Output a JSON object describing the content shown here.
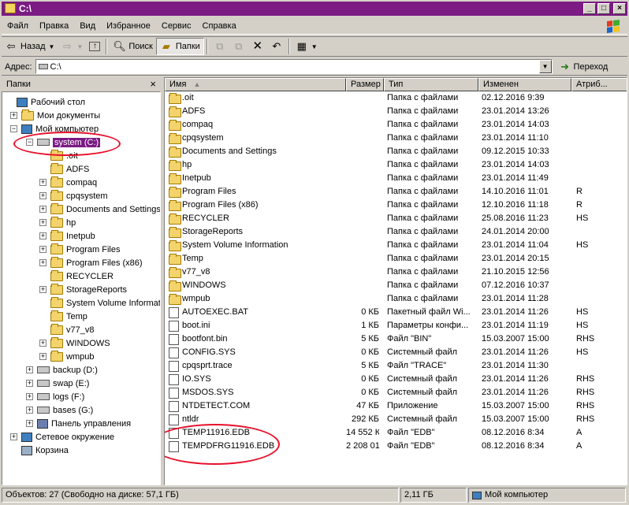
{
  "window": {
    "title": "C:\\"
  },
  "menu": [
    "Файл",
    "Правка",
    "Вид",
    "Избранное",
    "Сервис",
    "Справка"
  ],
  "toolbar": {
    "back": "Назад",
    "search": "Поиск",
    "folders": "Папки"
  },
  "address": {
    "label": "Адрес:",
    "value": "C:\\",
    "go": "Переход"
  },
  "left_pane": {
    "title": "Папки"
  },
  "tree": [
    {
      "label": "Рабочий стол",
      "level": 0,
      "icon": "desktop-icon",
      "expander": ""
    },
    {
      "label": "Мои документы",
      "level": 1,
      "icon": "folder-icon",
      "expander": "+"
    },
    {
      "label": "Мой компьютер",
      "level": 1,
      "icon": "computer-icon",
      "expander": "-"
    },
    {
      "label": "system (C:)",
      "level": 2,
      "icon": "drive-icon",
      "expander": "-",
      "selected": true
    },
    {
      "label": ".oit",
      "level": 3,
      "icon": "folder-icon",
      "expander": ""
    },
    {
      "label": "ADFS",
      "level": 3,
      "icon": "folder-icon",
      "expander": ""
    },
    {
      "label": "compaq",
      "level": 3,
      "icon": "folder-icon",
      "expander": "+"
    },
    {
      "label": "cpqsystem",
      "level": 3,
      "icon": "folder-icon",
      "expander": "+"
    },
    {
      "label": "Documents and Settings",
      "level": 3,
      "icon": "folder-icon",
      "expander": "+"
    },
    {
      "label": "hp",
      "level": 3,
      "icon": "folder-icon",
      "expander": "+"
    },
    {
      "label": "Inetpub",
      "level": 3,
      "icon": "folder-icon",
      "expander": "+"
    },
    {
      "label": "Program Files",
      "level": 3,
      "icon": "folder-icon",
      "expander": "+"
    },
    {
      "label": "Program Files (x86)",
      "level": 3,
      "icon": "folder-icon",
      "expander": "+"
    },
    {
      "label": "RECYCLER",
      "level": 3,
      "icon": "folder-icon",
      "expander": ""
    },
    {
      "label": "StorageReports",
      "level": 3,
      "icon": "folder-icon",
      "expander": "+"
    },
    {
      "label": "System Volume Information",
      "level": 3,
      "icon": "folder-icon",
      "expander": ""
    },
    {
      "label": "Temp",
      "level": 3,
      "icon": "folder-icon",
      "expander": ""
    },
    {
      "label": "v77_v8",
      "level": 3,
      "icon": "folder-icon",
      "expander": ""
    },
    {
      "label": "WINDOWS",
      "level": 3,
      "icon": "folder-icon",
      "expander": "+"
    },
    {
      "label": "wmpub",
      "level": 3,
      "icon": "folder-icon",
      "expander": "+"
    },
    {
      "label": "backup (D:)",
      "level": 2,
      "icon": "drive-icon",
      "expander": "+"
    },
    {
      "label": "swap (E:)",
      "level": 2,
      "icon": "drive-icon",
      "expander": "+"
    },
    {
      "label": "logs (F:)",
      "level": 2,
      "icon": "drive-icon",
      "expander": "+"
    },
    {
      "label": "bases (G:)",
      "level": 2,
      "icon": "drive-icon",
      "expander": "+"
    },
    {
      "label": "Панель управления",
      "level": 2,
      "icon": "control-panel-icon",
      "expander": "+"
    },
    {
      "label": "Сетевое окружение",
      "level": 1,
      "icon": "network-icon",
      "expander": "+"
    },
    {
      "label": "Корзина",
      "level": 1,
      "icon": "recycle-bin-icon",
      "expander": ""
    }
  ],
  "columns": {
    "name": "Имя",
    "size": "Размер",
    "type": "Тип",
    "modified": "Изменен",
    "attr": "Атриб..."
  },
  "files": [
    {
      "name": ".oit",
      "size": "",
      "type": "Папка с файлами",
      "modified": "02.12.2016 9:39",
      "attr": "",
      "icon": "folder"
    },
    {
      "name": "ADFS",
      "size": "",
      "type": "Папка с файлами",
      "modified": "23.01.2014 13:26",
      "attr": "",
      "icon": "folder"
    },
    {
      "name": "compaq",
      "size": "",
      "type": "Папка с файлами",
      "modified": "23.01.2014 14:03",
      "attr": "",
      "icon": "folder"
    },
    {
      "name": "cpqsystem",
      "size": "",
      "type": "Папка с файлами",
      "modified": "23.01.2014 11:10",
      "attr": "",
      "icon": "folder"
    },
    {
      "name": "Documents and Settings",
      "size": "",
      "type": "Папка с файлами",
      "modified": "09.12.2015 10:33",
      "attr": "",
      "icon": "folder"
    },
    {
      "name": "hp",
      "size": "",
      "type": "Папка с файлами",
      "modified": "23.01.2014 14:03",
      "attr": "",
      "icon": "folder"
    },
    {
      "name": "Inetpub",
      "size": "",
      "type": "Папка с файлами",
      "modified": "23.01.2014 11:49",
      "attr": "",
      "icon": "folder"
    },
    {
      "name": "Program Files",
      "size": "",
      "type": "Папка с файлами",
      "modified": "14.10.2016 11:01",
      "attr": "R",
      "icon": "folder"
    },
    {
      "name": "Program Files (x86)",
      "size": "",
      "type": "Папка с файлами",
      "modified": "12.10.2016 11:18",
      "attr": "R",
      "icon": "folder"
    },
    {
      "name": "RECYCLER",
      "size": "",
      "type": "Папка с файлами",
      "modified": "25.08.2016 11:23",
      "attr": "HS",
      "icon": "folder"
    },
    {
      "name": "StorageReports",
      "size": "",
      "type": "Папка с файлами",
      "modified": "24.01.2014 20:00",
      "attr": "",
      "icon": "folder"
    },
    {
      "name": "System Volume Information",
      "size": "",
      "type": "Папка с файлами",
      "modified": "23.01.2014 11:04",
      "attr": "HS",
      "icon": "folder"
    },
    {
      "name": "Temp",
      "size": "",
      "type": "Папка с файлами",
      "modified": "23.01.2014 20:15",
      "attr": "",
      "icon": "folder"
    },
    {
      "name": "v77_v8",
      "size": "",
      "type": "Папка с файлами",
      "modified": "21.10.2015 12:56",
      "attr": "",
      "icon": "folder"
    },
    {
      "name": "WINDOWS",
      "size": "",
      "type": "Папка с файлами",
      "modified": "07.12.2016 10:37",
      "attr": "",
      "icon": "folder"
    },
    {
      "name": "wmpub",
      "size": "",
      "type": "Папка с файлами",
      "modified": "23.01.2014 11:28",
      "attr": "",
      "icon": "folder"
    },
    {
      "name": "AUTOEXEC.BAT",
      "size": "0 КБ",
      "type": "Пакетный файл Wi...",
      "modified": "23.01.2014 11:26",
      "attr": "HS",
      "icon": "file"
    },
    {
      "name": "boot.ini",
      "size": "1 КБ",
      "type": "Параметры конфи...",
      "modified": "23.01.2014 11:19",
      "attr": "HS",
      "icon": "file"
    },
    {
      "name": "bootfont.bin",
      "size": "5 КБ",
      "type": "Файл \"BIN\"",
      "modified": "15.03.2007 15:00",
      "attr": "RHS",
      "icon": "file"
    },
    {
      "name": "CONFIG.SYS",
      "size": "0 КБ",
      "type": "Системный файл",
      "modified": "23.01.2014 11:26",
      "attr": "HS",
      "icon": "file"
    },
    {
      "name": "cpqsprt.trace",
      "size": "5 КБ",
      "type": "Файл \"TRACE\"",
      "modified": "23.01.2014 11:30",
      "attr": "",
      "icon": "file"
    },
    {
      "name": "IO.SYS",
      "size": "0 КБ",
      "type": "Системный файл",
      "modified": "23.01.2014 11:26",
      "attr": "RHS",
      "icon": "file"
    },
    {
      "name": "MSDOS.SYS",
      "size": "0 КБ",
      "type": "Системный файл",
      "modified": "23.01.2014 11:26",
      "attr": "RHS",
      "icon": "file"
    },
    {
      "name": "NTDETECT.COM",
      "size": "47 КБ",
      "type": "Приложение",
      "modified": "15.03.2007 15:00",
      "attr": "RHS",
      "icon": "file"
    },
    {
      "name": "ntldr",
      "size": "292 КБ",
      "type": "Системный файл",
      "modified": "15.03.2007 15:00",
      "attr": "RHS",
      "icon": "file"
    },
    {
      "name": "TEMP11916.EDB",
      "size": "14 552 КБ",
      "type": "Файл \"EDB\"",
      "modified": "08.12.2016 8:34",
      "attr": "A",
      "icon": "file"
    },
    {
      "name": "TEMPDFRG11916.EDB",
      "size": "2 208 016 КБ",
      "type": "Файл \"EDB\"",
      "modified": "08.12.2016 8:34",
      "attr": "A",
      "icon": "file"
    }
  ],
  "status": {
    "objects": "Объектов: 27 (Свободно на диске: 57,1 ГБ)",
    "size": "2,11 ГБ",
    "location": "Мой компьютер"
  },
  "colors": {
    "title_bar": "#7b1b83",
    "highlight_oval": "#e8102a",
    "folder": "#f3d36b"
  }
}
